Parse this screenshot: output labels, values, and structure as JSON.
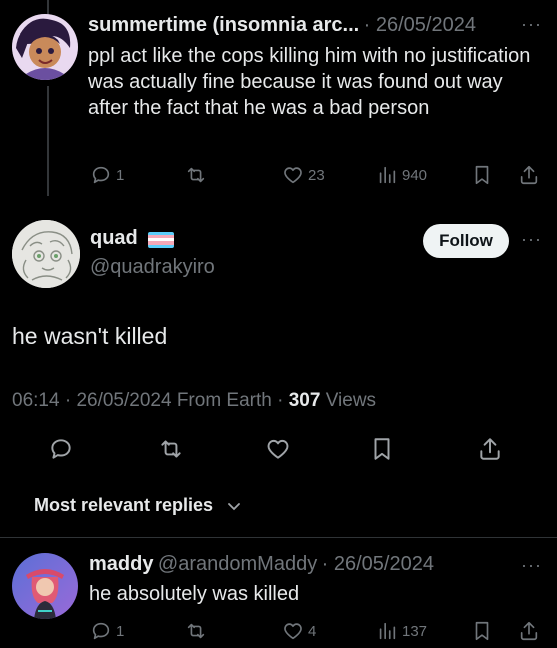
{
  "tweet1": {
    "author": "summertime (insomnia arc...",
    "date": "26/05/2024",
    "text": "ppl act like the cops killing him with no justification was actually fine because it was found out way after the fact that he was a bad person",
    "replies": "1",
    "likes": "23",
    "views": "940"
  },
  "main": {
    "author": "quad",
    "handle": "@quadrakyiro",
    "follow_label": "Follow",
    "text": "he wasn't killed",
    "time": "06:14",
    "date": "26/05/2024",
    "from": "From Earth",
    "views_count": "307",
    "views_label": "Views"
  },
  "sort": {
    "label": "Most relevant replies"
  },
  "reply1": {
    "author": "maddy",
    "handle": "@arandomMaddy",
    "date": "26/05/2024",
    "text": "he absolutely was killed",
    "replies": "1",
    "likes": "4",
    "views": "137"
  },
  "colors": {
    "background": "#000000",
    "text": "#e7e9ea",
    "muted": "#71767b",
    "divider": "#2f3336",
    "follow_bg": "#eff3f4"
  },
  "icons": [
    "reply-icon",
    "retweet-icon",
    "like-icon",
    "views-icon",
    "bookmark-icon",
    "share-icon",
    "more-icon",
    "chevron-down-icon",
    "trans-flag-emoji"
  ]
}
